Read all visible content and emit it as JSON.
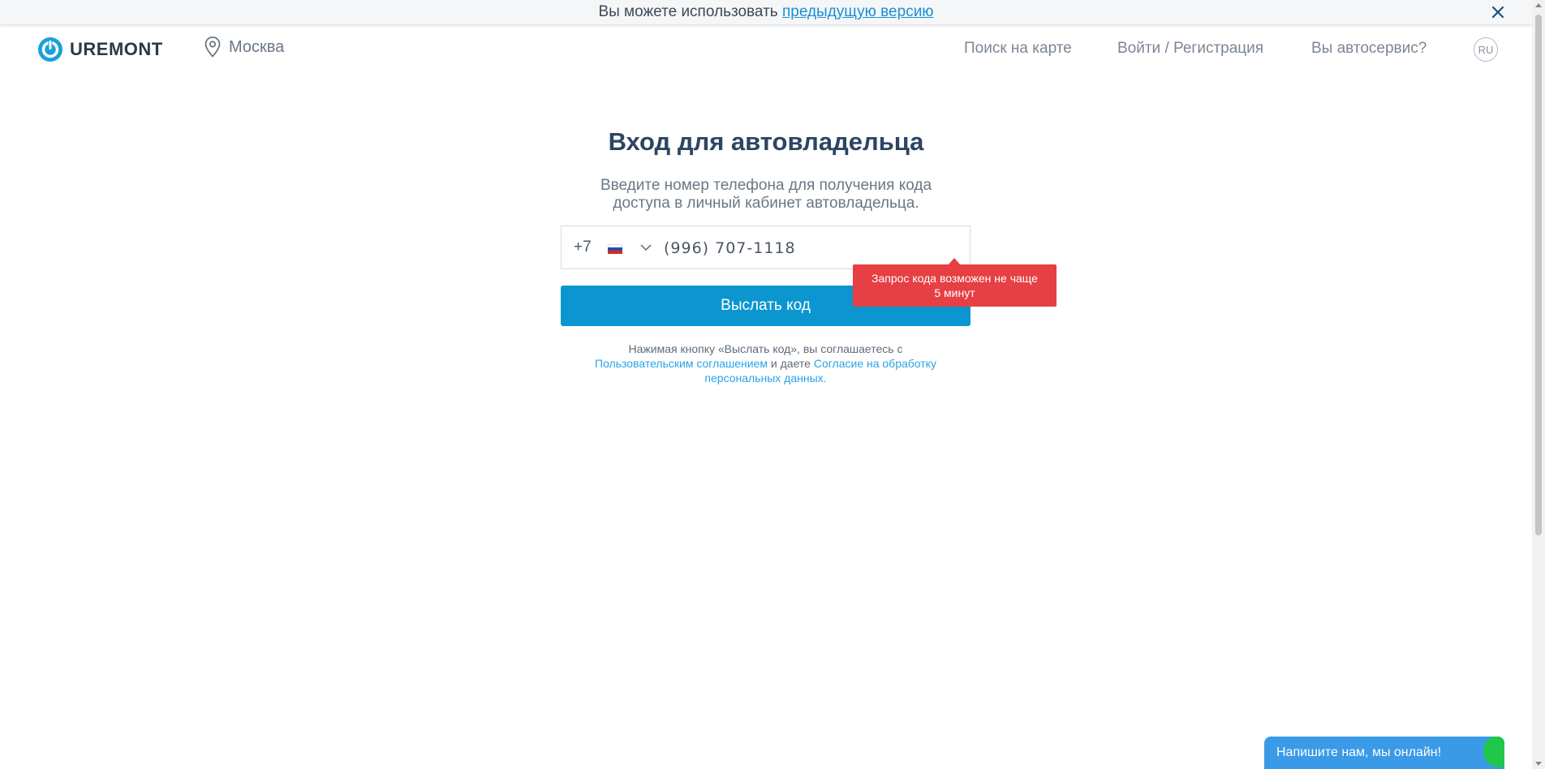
{
  "banner": {
    "text": "Вы можете использовать",
    "link": "предыдущую версию"
  },
  "header": {
    "logo": "UREMONT",
    "city": "Москва",
    "nav": {
      "map": "Поиск на карте",
      "login": "Войти / Регистрация",
      "service": "Вы автосервис?"
    },
    "lang": "RU"
  },
  "main": {
    "title": "Вход для автовладельца",
    "subtitle_line1": "Введите номер телефона для получения кода",
    "subtitle_line2": "доступа в личный кабинет автовладельца.",
    "phone": {
      "prefix": "+7",
      "country": "ru-flag-icon",
      "value": "(996) 707-1118"
    },
    "send_button": "Выслать код",
    "tooltip_line1": "Запрос кода возможен не чаще",
    "tooltip_line2": "5 минут",
    "agree_text1": "Нажимая кнопку «Выслать код», вы соглашаетесь с",
    "agree_link1": "Пользовательским соглашением",
    "agree_text2": "и даете",
    "agree_link2a": "Согласие на обработку",
    "agree_link2b": "персональных данных."
  },
  "chat": {
    "label": "Напишите нам, мы онлайн!"
  },
  "colors": {
    "accent": "#0c96d0",
    "error": "#e63f44",
    "title": "#2c4563",
    "link": "#29a3e6",
    "chat": "#3a9ae8",
    "online": "#20c74a"
  }
}
